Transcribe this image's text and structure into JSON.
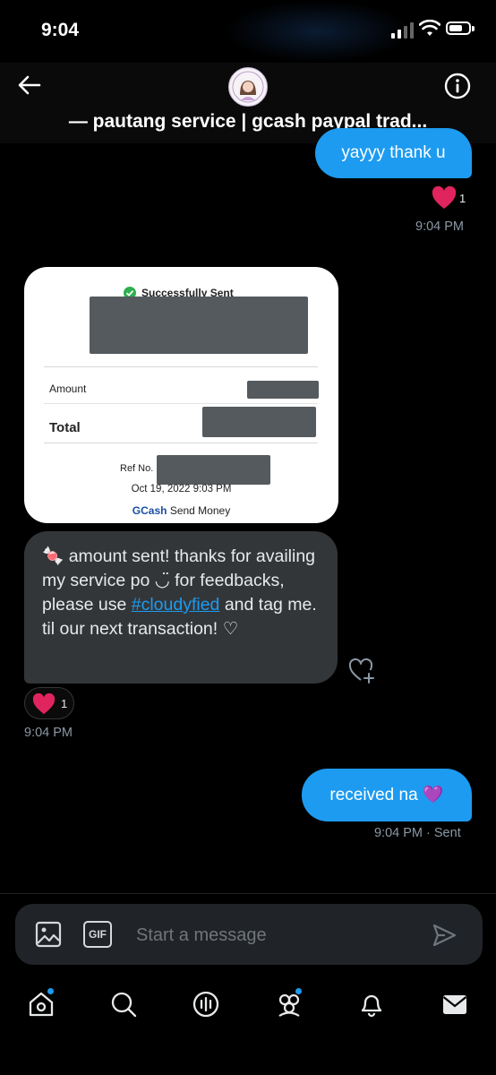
{
  "status_bar": {
    "time": "9:04"
  },
  "header": {
    "title": "— pautang service | gcash paypal trad..."
  },
  "messages": {
    "m1": {
      "text": "yayyy thank u",
      "reaction_count": "1",
      "time": "9:04 PM"
    },
    "receipt": {
      "status": "Successfully Sent",
      "amount_label": "Amount",
      "total_label": "Total",
      "ref_label": "Ref No.",
      "datetime": "Oct 19, 2022 9:03 PM",
      "brand": "GCash",
      "service": "Send Money"
    },
    "m2": {
      "text_before": "🍬 amount sent! thanks for availing my service po ◡̈ for feedbacks, please use ",
      "hashtag": "#cloudyfied",
      "text_after": " and tag me. til our next transaction! ♡",
      "reaction_count": "1",
      "time": "9:04 PM"
    },
    "m3": {
      "text": "received na 💜",
      "time": "9:04 PM",
      "status": "· Sent"
    }
  },
  "composer": {
    "placeholder": "Start a message",
    "gif_label": "GIF"
  },
  "colors": {
    "accent": "#1d9bf0",
    "bubble_in": "#333639",
    "heart": "#f91880"
  }
}
